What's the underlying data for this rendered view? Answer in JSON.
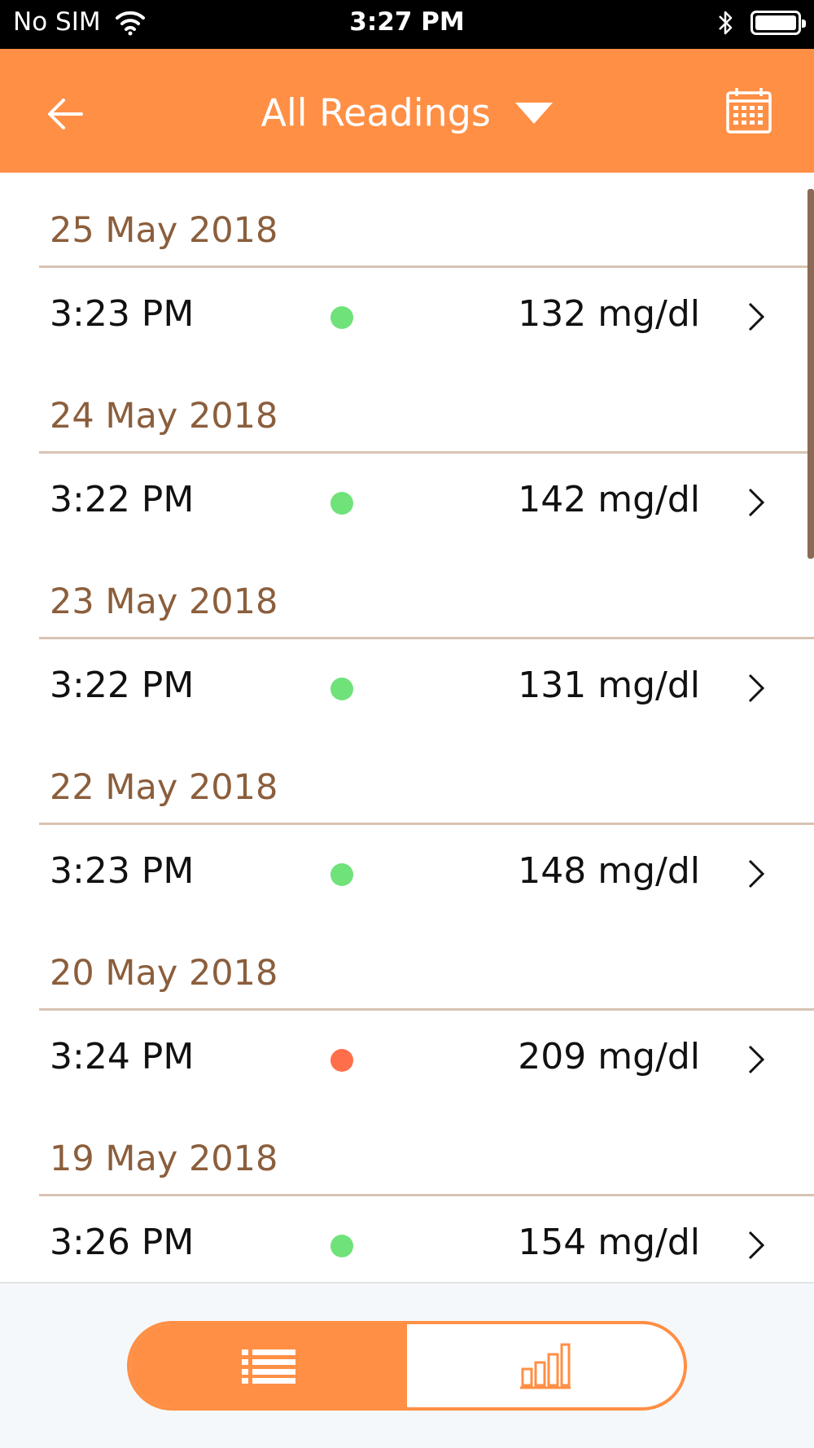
{
  "status_bar": {
    "carrier": "No SIM",
    "time": "3:27 PM"
  },
  "nav": {
    "title": "All Readings",
    "back_icon": "arrow-left-icon",
    "caret_icon": "caret-down-icon",
    "calendar_icon": "calendar-icon"
  },
  "readings": [
    {
      "date": "25 May 2018",
      "time": "3:23 PM",
      "value": "132 mg/dl",
      "status": "normal"
    },
    {
      "date": "24 May 2018",
      "time": "3:22 PM",
      "value": "142 mg/dl",
      "status": "normal"
    },
    {
      "date": "23 May 2018",
      "time": "3:22 PM",
      "value": "131 mg/dl",
      "status": "normal"
    },
    {
      "date": "22 May 2018",
      "time": "3:23 PM",
      "value": "148 mg/dl",
      "status": "normal"
    },
    {
      "date": "20 May 2018",
      "time": "3:24 PM",
      "value": "209 mg/dl",
      "status": "high"
    },
    {
      "date": "19 May 2018",
      "time": "3:26 PM",
      "value": "154 mg/dl",
      "status": "normal"
    }
  ],
  "status_colors": {
    "normal": "#6fe27a",
    "high": "#ff6e4a"
  },
  "colors": {
    "accent": "#ff8f45",
    "date_text": "#8b5e3c"
  },
  "bottom_tabs": [
    {
      "icon": "list-icon",
      "active": true
    },
    {
      "icon": "bar-chart-icon",
      "active": false
    }
  ]
}
